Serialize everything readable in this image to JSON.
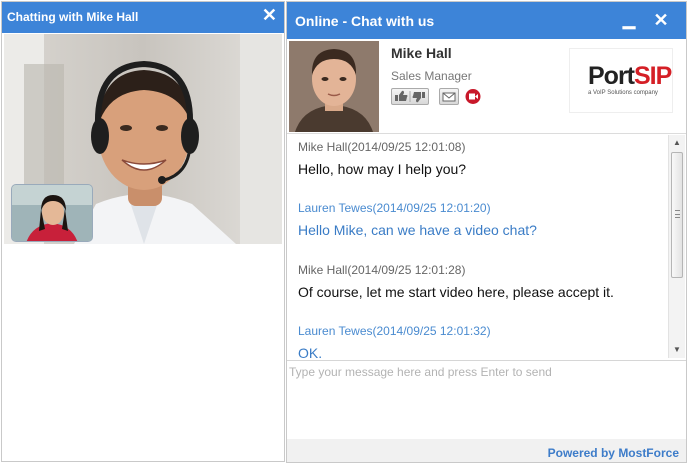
{
  "video_window": {
    "title": "Chatting with Mike Hall",
    "close_glyph": "✕",
    "close_icon": "close-icon"
  },
  "chat_window": {
    "title": "Online - Chat with us",
    "minimize_glyph": "▁",
    "close_glyph": "✕",
    "minimize_icon": "minimize-icon",
    "close_icon": "close-icon",
    "accent_color": "#3d84d8"
  },
  "agent": {
    "name": "Mike Hall",
    "role": "Sales Manager",
    "actions": [
      "thumbs-up-icon",
      "thumbs-down-icon",
      "email-icon",
      "video-call-icon"
    ]
  },
  "vendor_logo": {
    "part1": "Port",
    "part2": "SIP",
    "tagline": "a VoIP Solutions company"
  },
  "messages": [
    {
      "sender": "agent",
      "meta": "Mike Hall(2014/09/25 12:01:08)",
      "text": "Hello, how may I help you?"
    },
    {
      "sender": "visitor",
      "meta": "Lauren Tewes(2014/09/25 12:01:20)",
      "text": "Hello Mike, can we have a video chat?"
    },
    {
      "sender": "agent",
      "meta": "Mike Hall(2014/09/25 12:01:28)",
      "text": "Of course, let me start video here, please accept it."
    },
    {
      "sender": "visitor",
      "meta": "Lauren Tewes(2014/09/25 12:01:32)",
      "text": "OK."
    }
  ],
  "scrollbar": {
    "up_glyph": "▲",
    "down_glyph": "▼"
  },
  "composer": {
    "placeholder": "Type your message here and press Enter to send",
    "value": ""
  },
  "footer": {
    "powered_by": "Powered by MostForce"
  }
}
